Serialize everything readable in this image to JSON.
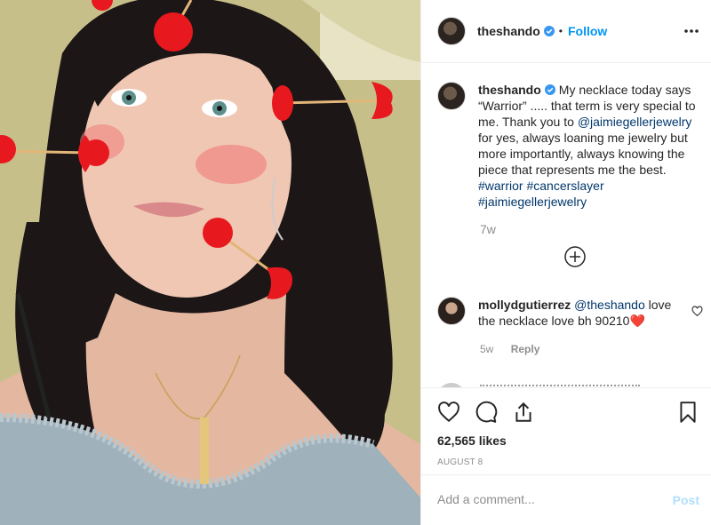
{
  "post": {
    "author": {
      "username": "theshando",
      "verified": true,
      "follow_label": "Follow",
      "separator": "•"
    },
    "caption": {
      "username": "theshando",
      "text_before_mention": "My necklace today says “Warrior” ..... that term is very special to me. Thank you to",
      "mention": "@jaimiegellerjewelry",
      "text_after_mention": "for yes, always loaning me jewelry but more importantly, always knowing the piece that represents me the best.",
      "hashtags": [
        "#warrior",
        "#cancerslayer",
        "#jaimiegellerjewelry"
      ],
      "time": "7w"
    },
    "comments": [
      {
        "username": "mollydgutierrez",
        "mention": "@theshando",
        "text": "love the necklace love bh 90210",
        "emoji": "❤️",
        "time": "5w",
        "reply_label": "Reply"
      }
    ],
    "likes": "62,565 likes",
    "date": "AUGUST 8",
    "add_comment_placeholder": "Add a comment...",
    "post_button_label": "Post"
  },
  "icons": {
    "more": "more-options-icon",
    "load_more": "plus-circle-icon",
    "like": "heart-outline-icon",
    "comment": "comment-bubble-icon",
    "share": "share-icon",
    "save": "bookmark-icon",
    "comment_like": "small-heart-icon"
  },
  "colors": {
    "link": "#00376b",
    "follow": "#0095f6",
    "muted": "#8e8e8e",
    "post_disabled": "#b2dffc",
    "heart": "#e0245e"
  }
}
